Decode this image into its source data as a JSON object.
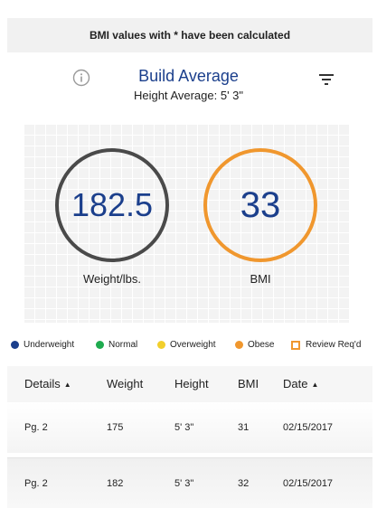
{
  "banner": {
    "text": "BMI values with * have been calculated"
  },
  "header": {
    "title": "Build Average",
    "subtitle": "Height Average: 5' 3\""
  },
  "metrics": {
    "weight": {
      "value": "182.5",
      "label": "Weight/lbs.",
      "ring_color": "#4a4a4a"
    },
    "bmi": {
      "value": "33",
      "label": "BMI",
      "ring_color": "#f0972e"
    }
  },
  "legend": [
    {
      "label": "Underweight",
      "color": "#1b3f8c",
      "shape": "dot"
    },
    {
      "label": "Normal",
      "color": "#1fab4f",
      "shape": "dot"
    },
    {
      "label": "Overweight",
      "color": "#f2cf2c",
      "shape": "dot"
    },
    {
      "label": "Obese",
      "color": "#f0972e",
      "shape": "dot"
    },
    {
      "label": "Review Req'd",
      "color": "#f0972e",
      "shape": "square-outline"
    }
  ],
  "table": {
    "columns": [
      "Details",
      "Weight",
      "Height",
      "BMI",
      "Date"
    ],
    "sortable_columns": [
      "Details",
      "Date"
    ],
    "rows": [
      [
        "Pg. 2",
        "175",
        "5' 3\"",
        "31",
        "02/15/2017"
      ],
      [
        "Pg. 2",
        "182",
        "5' 3\"",
        "32",
        "02/15/2017"
      ]
    ]
  },
  "icons": {
    "info": "info-icon",
    "filter": "filter-icon",
    "sort": "sort-caret-up-icon"
  }
}
